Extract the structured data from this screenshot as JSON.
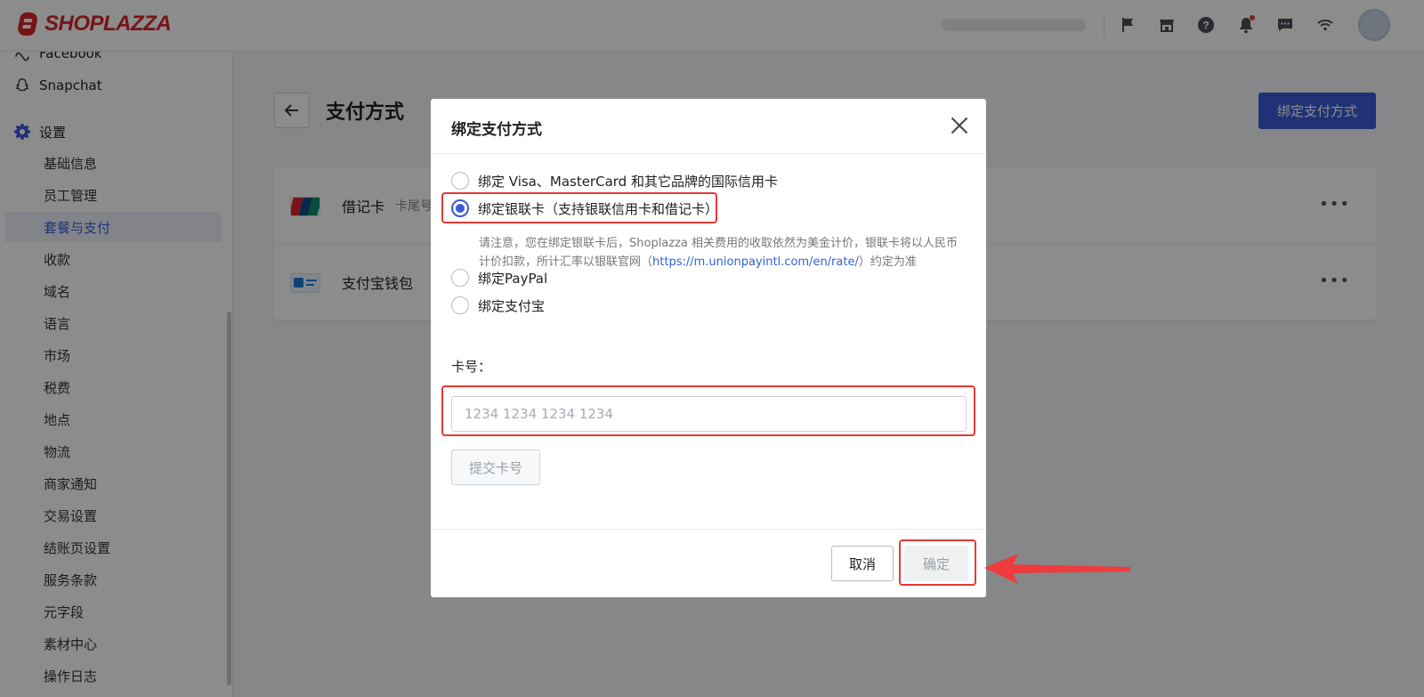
{
  "brand": {
    "name": "SHOPLAZZA",
    "color": "#d8262c"
  },
  "topbar": {
    "icons": [
      "flag-icon",
      "store-icon",
      "help-icon",
      "bell-icon",
      "chat-icon",
      "wifi-icon"
    ]
  },
  "sidebar": {
    "channels": [
      {
        "label": "Facebook",
        "icon": "facebook-icon"
      },
      {
        "label": "Snapchat",
        "icon": "snapchat-icon"
      }
    ],
    "settings": {
      "label": "设置",
      "icon": "gear-icon",
      "items": [
        {
          "label": "基础信息"
        },
        {
          "label": "员工管理"
        },
        {
          "label": "套餐与支付",
          "active": true
        },
        {
          "label": "收款"
        },
        {
          "label": "域名"
        },
        {
          "label": "语言"
        },
        {
          "label": "市场"
        },
        {
          "label": "税费"
        },
        {
          "label": "地点"
        },
        {
          "label": "物流"
        },
        {
          "label": "商家通知"
        },
        {
          "label": "交易设置"
        },
        {
          "label": "结账页设置"
        },
        {
          "label": "服务条款"
        },
        {
          "label": "元字段"
        },
        {
          "label": "素材中心"
        },
        {
          "label": "操作日志"
        }
      ]
    }
  },
  "main": {
    "title": "支付方式",
    "bind_button": "绑定支付方式",
    "methods": [
      {
        "name": "借记卡",
        "tail": "卡尾号",
        "logo": "unionpay-logo"
      },
      {
        "name": "支付宝钱包",
        "logo": "alipay-logo"
      }
    ],
    "more": "•••"
  },
  "modal": {
    "title": "绑定支付方式",
    "options": [
      {
        "label": "绑定 Visa、MasterCard 和其它品牌的国际信用卡",
        "checked": false
      },
      {
        "label": "绑定银联卡（支持银联信用卡和借记卡）",
        "checked": true
      },
      {
        "label": "绑定PayPal",
        "checked": false
      },
      {
        "label": "绑定支付宝",
        "checked": false
      }
    ],
    "note": {
      "prefix": "请注意，您在绑定银联卡后，Shoplazza 相关费用的收取依然为美金计价，银联卡将以人民币计价扣款，所计汇率以银联官网（",
      "link": "https://m.unionpayintl.com/en/rate/",
      "suffix": "）约定为准"
    },
    "card_label": "卡号：",
    "card_placeholder": "1234 1234 1234 1234",
    "card_value": "",
    "submit": "提交卡号",
    "cancel": "取消",
    "confirm": "确定"
  },
  "colors": {
    "accent": "#3b5ad8",
    "highlight": "#e53935",
    "link": "#2e63d6"
  }
}
